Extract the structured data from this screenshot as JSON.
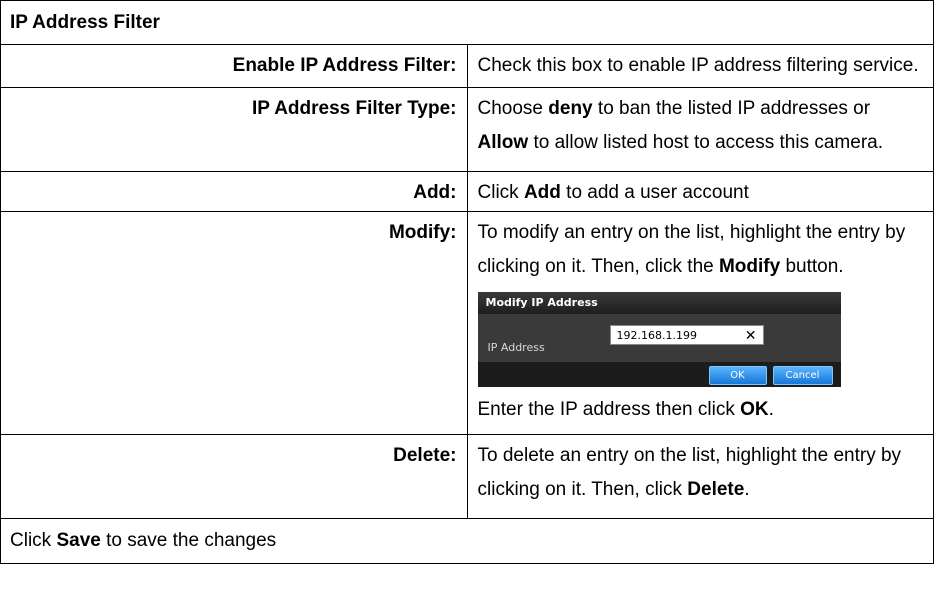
{
  "title": "IP Address Filter",
  "rows": [
    {
      "label": "Enable IP Address Filter:",
      "desc": [
        "Check this box to enable IP address filtering service."
      ]
    },
    {
      "label": "IP Address Filter Type:",
      "desc": [
        "Choose ",
        "deny",
        " to ban the listed IP addresses or ",
        "Allow",
        " to allow listed host to access this camera."
      ]
    },
    {
      "label": "Add:",
      "desc": [
        "Click ",
        "Add",
        " to add a user account"
      ]
    },
    {
      "label": "Modify:",
      "desc": [
        "To modify an entry on the list, highlight the entry by clicking on it. Then, click the ",
        "Modify",
        " button."
      ],
      "after": [
        "Enter the IP address then click ",
        "OK",
        "."
      ]
    },
    {
      "label": "Delete:",
      "desc": [
        "To delete an entry on the list, highlight the entry by clicking on it. Then, click ",
        "Delete",
        "."
      ]
    }
  ],
  "dialog": {
    "title": "Modify IP Address",
    "field_label": "IP Address",
    "field_value": "192.168.1.199",
    "clear_glyph": "✕",
    "ok_label": "OK",
    "cancel_label": "Cancel"
  },
  "footer": [
    "Click ",
    "Save",
    " to save the changes"
  ]
}
